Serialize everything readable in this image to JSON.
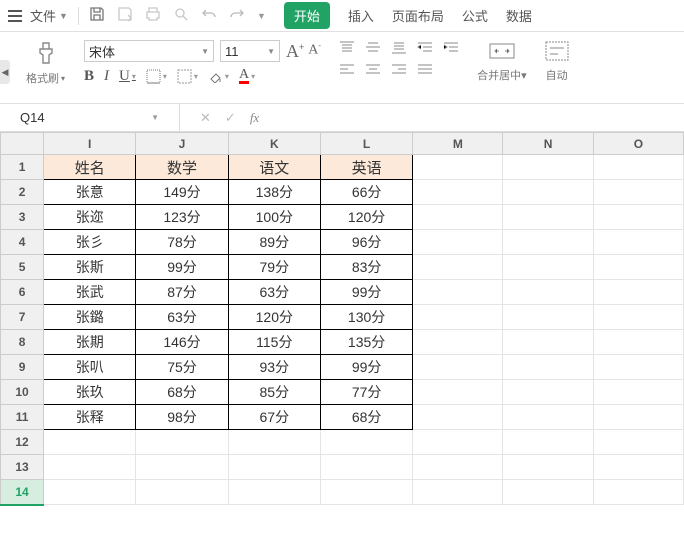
{
  "menu": {
    "file": "文件"
  },
  "tabs": {
    "start": "开始",
    "insert": "插入",
    "layout": "页面布局",
    "formula": "公式",
    "data": "数据"
  },
  "ribbon": {
    "painter": "格式刷",
    "font_name": "宋体",
    "font_size": "11",
    "merge": "合并居中",
    "wrap": "自动"
  },
  "fx": {
    "cell_ref": "Q14"
  },
  "columns": [
    "I",
    "J",
    "K",
    "L",
    "M",
    "N",
    "O"
  ],
  "rows": [
    "1",
    "2",
    "3",
    "4",
    "5",
    "6",
    "7",
    "8",
    "9",
    "10",
    "11",
    "12",
    "13",
    "14"
  ],
  "active_row": 14,
  "headers": [
    "姓名",
    "数学",
    "语文",
    "英语"
  ],
  "table": [
    [
      "张意",
      "149分",
      "138分",
      "66分"
    ],
    [
      "张迩",
      "123分",
      "100分",
      "120分"
    ],
    [
      "张彡",
      "78分",
      "89分",
      "96分"
    ],
    [
      "张斯",
      "99分",
      "79分",
      "83分"
    ],
    [
      "张武",
      "87分",
      "63分",
      "99分"
    ],
    [
      "张鏴",
      "63分",
      "120分",
      "130分"
    ],
    [
      "张期",
      "146分",
      "115分",
      "135分"
    ],
    [
      "张叭",
      "75分",
      "93分",
      "99分"
    ],
    [
      "张玖",
      "68分",
      "85分",
      "77分"
    ],
    [
      "张释",
      "98分",
      "67分",
      "68分"
    ]
  ]
}
